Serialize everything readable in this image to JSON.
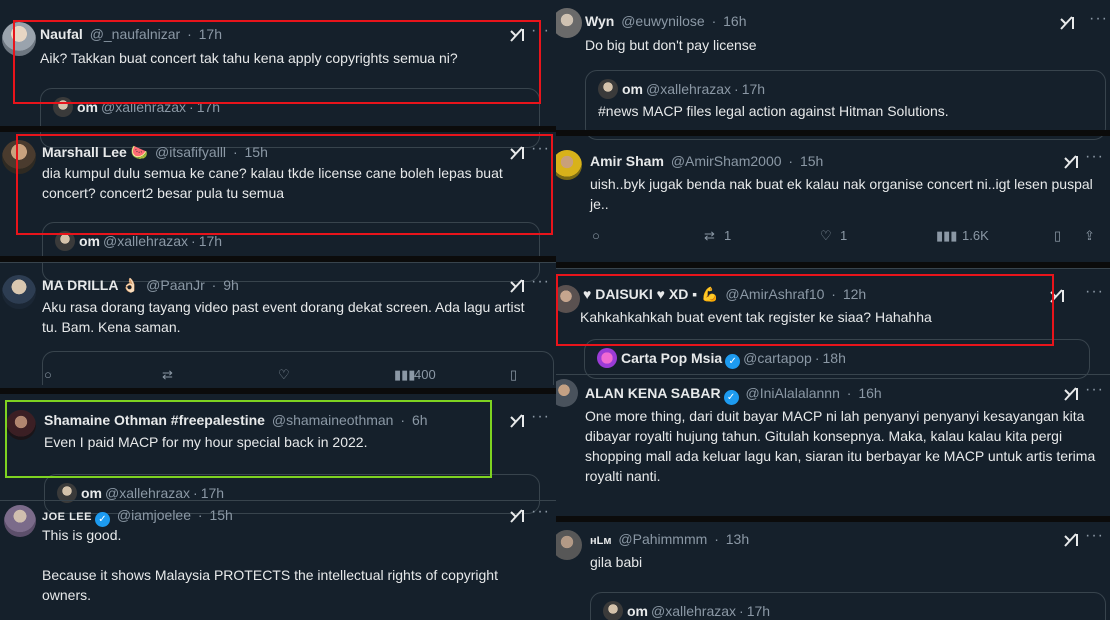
{
  "common": {
    "more": "···"
  },
  "left": {
    "t1": {
      "name": "Naufal",
      "handle": "@_naufalnizar",
      "time": "17h",
      "text": "Aik? Takkan buat concert tak tahu kena apply copyrights semua ni?",
      "quote_name": "om",
      "quote_handle": "@xallehrazax",
      "quote_time": "17h"
    },
    "t2": {
      "name": "Marshall Lee 🍉",
      "handle": "@itsafifyalll",
      "time": "15h",
      "text": "dia kumpul dulu semua ke cane? kalau tkde license cane boleh lepas buat concert? concert2 besar pula tu semua",
      "quote_name": "om",
      "quote_handle": "@xallehrazax",
      "quote_time": "17h"
    },
    "t3": {
      "name": "MA DRILLA 👌🏻",
      "handle": "@PaanJr",
      "time": "9h",
      "text": "Aku rasa dorang tayang video past event dorang dekat screen. Ada lagu artist tu. Bam. Kena saman.",
      "views": "400"
    },
    "t4": {
      "name": "Shamaine Othman #freepalestine",
      "handle": "@shamaineothman",
      "time": "6h",
      "text": "Even I paid MACP for my hour special back in 2022.",
      "quote_name": "om",
      "quote_handle": "@xallehrazax",
      "quote_time": "17h"
    },
    "t5": {
      "name": "JOE LEE",
      "handle": "@iamjoelee",
      "time": "15h",
      "text1": "This is good.",
      "text2": "Because it shows Malaysia PROTECTS the intellectual rights of copyright owners."
    }
  },
  "right": {
    "t1": {
      "name": "Wyn",
      "handle": "@euwynilose",
      "time": "16h",
      "text": "Do big but don't pay license",
      "quote_name": "om",
      "quote_handle": "@xallehrazax",
      "quote_time": "17h",
      "quote_text": "#news MACP files legal action against Hitman Solutions."
    },
    "t2": {
      "name": "Amir Sham",
      "handle": "@AmirSham2000",
      "time": "15h",
      "text": "uish..byk jugak benda nak buat ek kalau nak organise concert ni..igt lesen puspal je..",
      "retweets": "1",
      "likes": "1",
      "views": "1.6K"
    },
    "t3": {
      "name": "♥ DAISUKI ♥ XD ▪ 💪",
      "handle": "@AmirAshraf10",
      "time": "12h",
      "text": "Kahkahkahkah buat event tak register ke siaa? Hahahha",
      "quote_name": "Carta Pop Msia",
      "quote_time": "18h",
      "quote_handle": "@cartapop"
    },
    "t4": {
      "name": "ALAN KENA SABAR",
      "handle": "@IniAlalalannn",
      "time": "16h",
      "text": "One more thing, dari duit bayar MACP ni lah penyanyi penyanyi kesayangan kita dibayar royalti hujung tahun. Gitulah konsepnya. Maka, kalau kalau kita pergi shopping mall ada keluar lagu kan, siaran itu berbayar ke MACP untuk artis terima royalti nanti."
    },
    "t5": {
      "name": "нLм",
      "handle": "@Pahimmmm",
      "time": "13h",
      "text": "gila babi",
      "quote_name": "om",
      "quote_handle": "@xallehrazax",
      "quote_time": "17h"
    }
  },
  "colors": {
    "background": "#15202b",
    "text": "#e7e9ea",
    "muted": "#8b98a5",
    "border": "#38444d",
    "highlight_red": "#e8141b",
    "highlight_green": "#7ed321",
    "verified": "#1d9bf0"
  }
}
